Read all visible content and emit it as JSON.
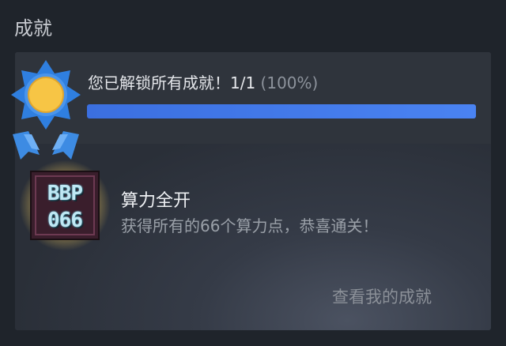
{
  "section": {
    "title": "成就"
  },
  "summary": {
    "text": "您已解锁所有成就！1/1",
    "percent_text": "(100%)",
    "progress": 1.0,
    "accent_color": "#4a83f2"
  },
  "achievement": {
    "icon_line1": "BBP",
    "icon_line2": "066",
    "name": "算力全开",
    "description": "获得所有的66个算力点，恭喜通关！"
  },
  "actions": {
    "view_label": "查看我的成就"
  }
}
